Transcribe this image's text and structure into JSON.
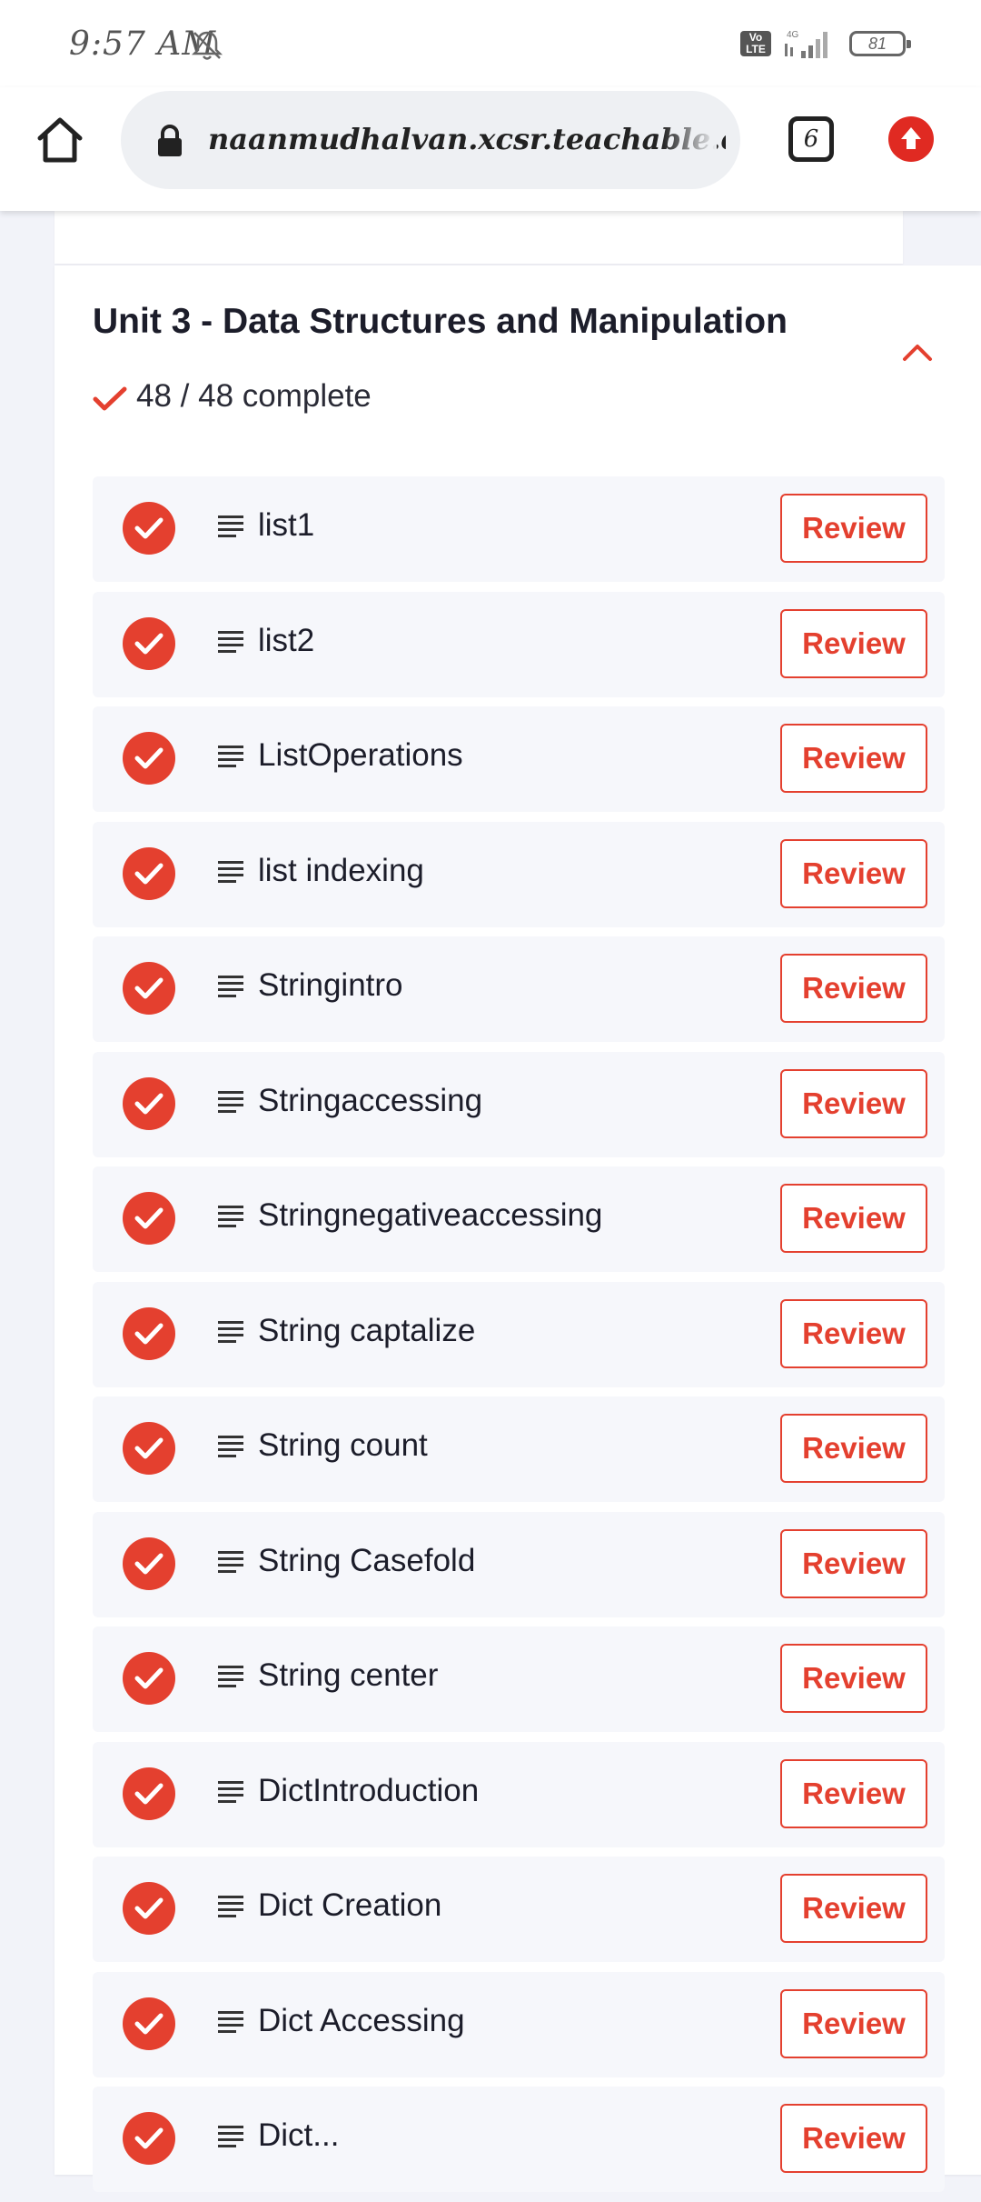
{
  "status_bar": {
    "time": "9:57 AM",
    "volte_line1": "Vo",
    "volte_line2": "LTE",
    "network": "4G",
    "battery": "81"
  },
  "browser": {
    "url": "naanmudhalvan.xcsr.teachable.com/cours",
    "tab_count": "6"
  },
  "unit": {
    "title": "Unit 3 - Data Structures and Manipulation",
    "progress": "48 / 48 complete"
  },
  "lessons": [
    {
      "title": "list1",
      "action": "Review"
    },
    {
      "title": "list2",
      "action": "Review"
    },
    {
      "title": "ListOperations",
      "action": "Review"
    },
    {
      "title": "list indexing",
      "action": "Review"
    },
    {
      "title": "Stringintro",
      "action": "Review"
    },
    {
      "title": "Stringaccessing",
      "action": "Review"
    },
    {
      "title": "Stringnegativeaccessing",
      "action": "Review"
    },
    {
      "title": "String captalize",
      "action": "Review"
    },
    {
      "title": "String count",
      "action": "Review"
    },
    {
      "title": "String Casefold",
      "action": "Review"
    },
    {
      "title": "String center",
      "action": "Review"
    },
    {
      "title": "DictIntroduction",
      "action": "Review"
    },
    {
      "title": "Dict Creation",
      "action": "Review"
    },
    {
      "title": "Dict Accessing",
      "action": "Review"
    },
    {
      "title": "Dict...",
      "action": "Review"
    }
  ],
  "colors": {
    "accent": "#e4402f",
    "row_background": "#f6f7fb",
    "page_background": "#f2f3f9"
  }
}
